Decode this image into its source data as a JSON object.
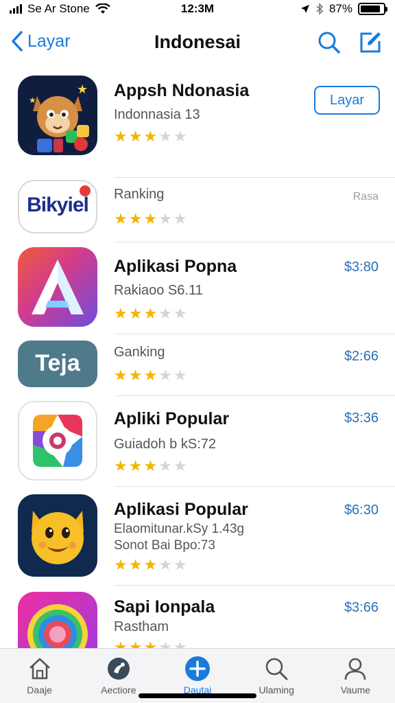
{
  "status_bar": {
    "carrier": "Se Ar Stone",
    "time": "12:3M",
    "battery_text": "87%",
    "battery_level": 0.87
  },
  "nav": {
    "back_label": "Layar",
    "title": "Indonesai"
  },
  "apps": [
    {
      "name": "Appsh Ndonasia",
      "subtitle": "Indonnasia 13",
      "rating": 3,
      "action_label": "Layar",
      "icon": "cartoon-cat-icon"
    },
    {
      "name": "",
      "subtitle": "Ranking",
      "rating": 3,
      "price": "Rasa",
      "icon": "bikyiel-logo-icon",
      "icon_text": "Bikyiel"
    },
    {
      "name": "Aplikasi Popna",
      "subtitle": "Rakiaoo S6.11",
      "rating": 3,
      "price": "$3:80",
      "icon": "letter-a-icon"
    },
    {
      "name": "",
      "subtitle": "Ganking",
      "rating": 3,
      "price": "$2:66",
      "icon": "teja-logo-icon",
      "icon_text": "Teja"
    },
    {
      "name": "Apliki Popular",
      "subtitle": "Guiadoh b kS:72",
      "rating": 3,
      "price": "$3:36",
      "icon": "colorful-ring-icon"
    },
    {
      "name": "Aplikasi Popular",
      "subtitle": "Elaomitunar.kSy 1.43g",
      "subtitle2": "Sonot Bai Bpo:73",
      "rating": 3,
      "price": "$6:30",
      "icon": "smiling-cat-icon"
    },
    {
      "name": "Sapi Ionpala",
      "subtitle": "Rastham",
      "rating": 3,
      "price": "$3:66",
      "icon": "swirl-icon"
    }
  ],
  "tabs": [
    {
      "label": "Daaje",
      "icon": "home-icon",
      "active": false
    },
    {
      "label": "Aectiore",
      "icon": "discover-icon",
      "active": false
    },
    {
      "label": "Dautai",
      "icon": "plus-circle-icon",
      "active": true
    },
    {
      "label": "Ulaming",
      "icon": "search-icon",
      "active": false
    },
    {
      "label": "Vaume",
      "icon": "person-icon",
      "active": false
    }
  ],
  "colors": {
    "accent": "#1a7ad9",
    "star": "#f4b400",
    "price": "#2a6fb5"
  }
}
